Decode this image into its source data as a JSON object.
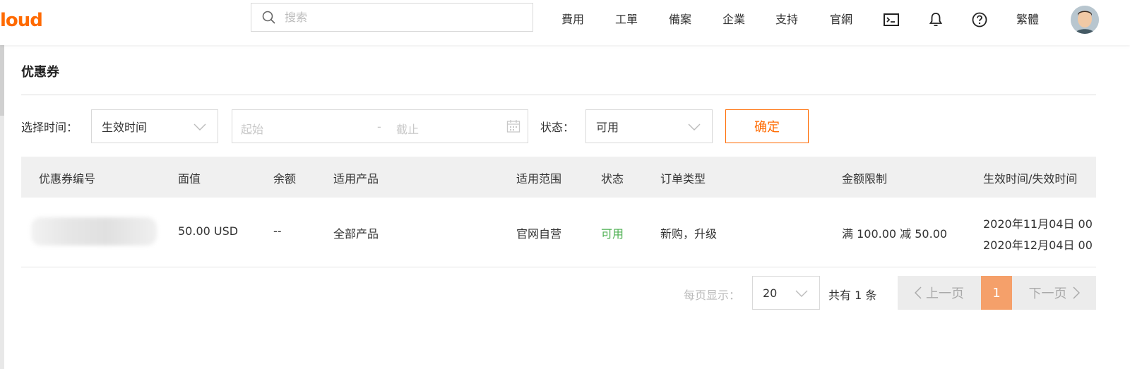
{
  "header": {
    "logo_text": "loud",
    "search_placeholder": "搜索",
    "nav": [
      "費用",
      "工單",
      "備案",
      "企業",
      "支持",
      "官網"
    ],
    "language": "繁體",
    "icons": [
      "terminal-icon",
      "bell-icon",
      "help-icon"
    ]
  },
  "page": {
    "title": "优惠券"
  },
  "filters": {
    "time_label": "选择时间：",
    "time_type": "生效时间",
    "start_placeholder": "起始",
    "range_separator": "-",
    "end_placeholder": "截止",
    "status_label": "状态：",
    "status_value": "可用",
    "confirm": "确定"
  },
  "table": {
    "columns": [
      "优惠券编号",
      "面值",
      "余额",
      "适用产品",
      "适用范围",
      "状态",
      "订单类型",
      "金额限制",
      "生效时间/失效时间"
    ],
    "rows": [
      {
        "id": "",
        "face_value": "50.00 USD",
        "balance": "--",
        "products": "全部产品",
        "scope": "官网自营",
        "status": "可用",
        "order_type": "新购，升级",
        "limit": "满 100.00 减 50.00",
        "start": "2020年11月04日 00",
        "end": "2020年12月04日 00"
      }
    ]
  },
  "pagination": {
    "per_page_label": "每页显示：",
    "per_page": "20",
    "total": "共有 1 条",
    "prev": "上一页",
    "current": "1",
    "next": "下一页"
  },
  "colors": {
    "accent": "#ff6a00",
    "status_ok": "#4caf50"
  }
}
